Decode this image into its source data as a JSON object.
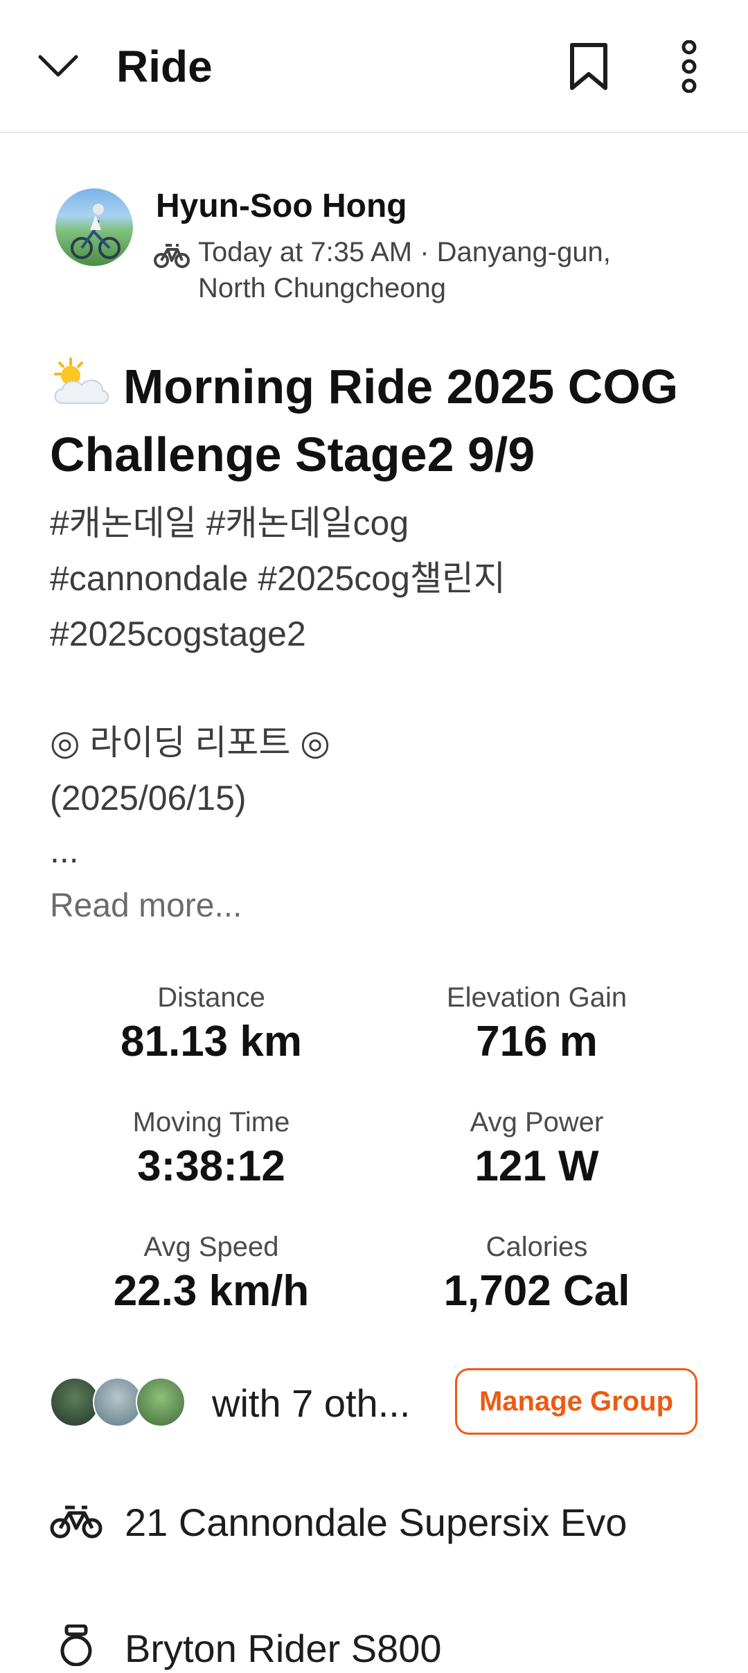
{
  "header": {
    "title": "Ride"
  },
  "athlete": {
    "name": "Hyun-Soo Hong",
    "meta_line1": "Today at 7:35 AM · Danyang-gun,",
    "meta_line2": "North Chungcheong"
  },
  "activity": {
    "title_line1": "Morning Ride 2025 COG",
    "title_line2": "Challenge  Stage2  9/9",
    "weather_icon": "sun-behind-cloud",
    "description_lines": [
      "#캐논데일 #캐논데일cog",
      "#cannondale #2025cog챌린지",
      "#2025cogstage2",
      "◎ 라이딩 리포트 ◎",
      "(2025/06/15)",
      "..."
    ],
    "read_more": "Read more..."
  },
  "stats": [
    {
      "label": "Distance",
      "value": "81.13 km"
    },
    {
      "label": "Elevation Gain",
      "value": "716 m"
    },
    {
      "label": "Moving Time",
      "value": "3:38:12"
    },
    {
      "label": "Avg Power",
      "value": "121 W"
    },
    {
      "label": "Avg Speed",
      "value": "22.3 km/h"
    },
    {
      "label": "Calories",
      "value": "1,702 Cal"
    }
  ],
  "group": {
    "with_text": "with 7 oth...",
    "manage_label": "Manage Group"
  },
  "gear": {
    "bike": "21 Cannondale Supersix Evo",
    "device": "Bryton Rider S800"
  },
  "colors": {
    "accent": "#f05a12",
    "text": "#1d1d1d",
    "muted": "#6b6b6b"
  }
}
